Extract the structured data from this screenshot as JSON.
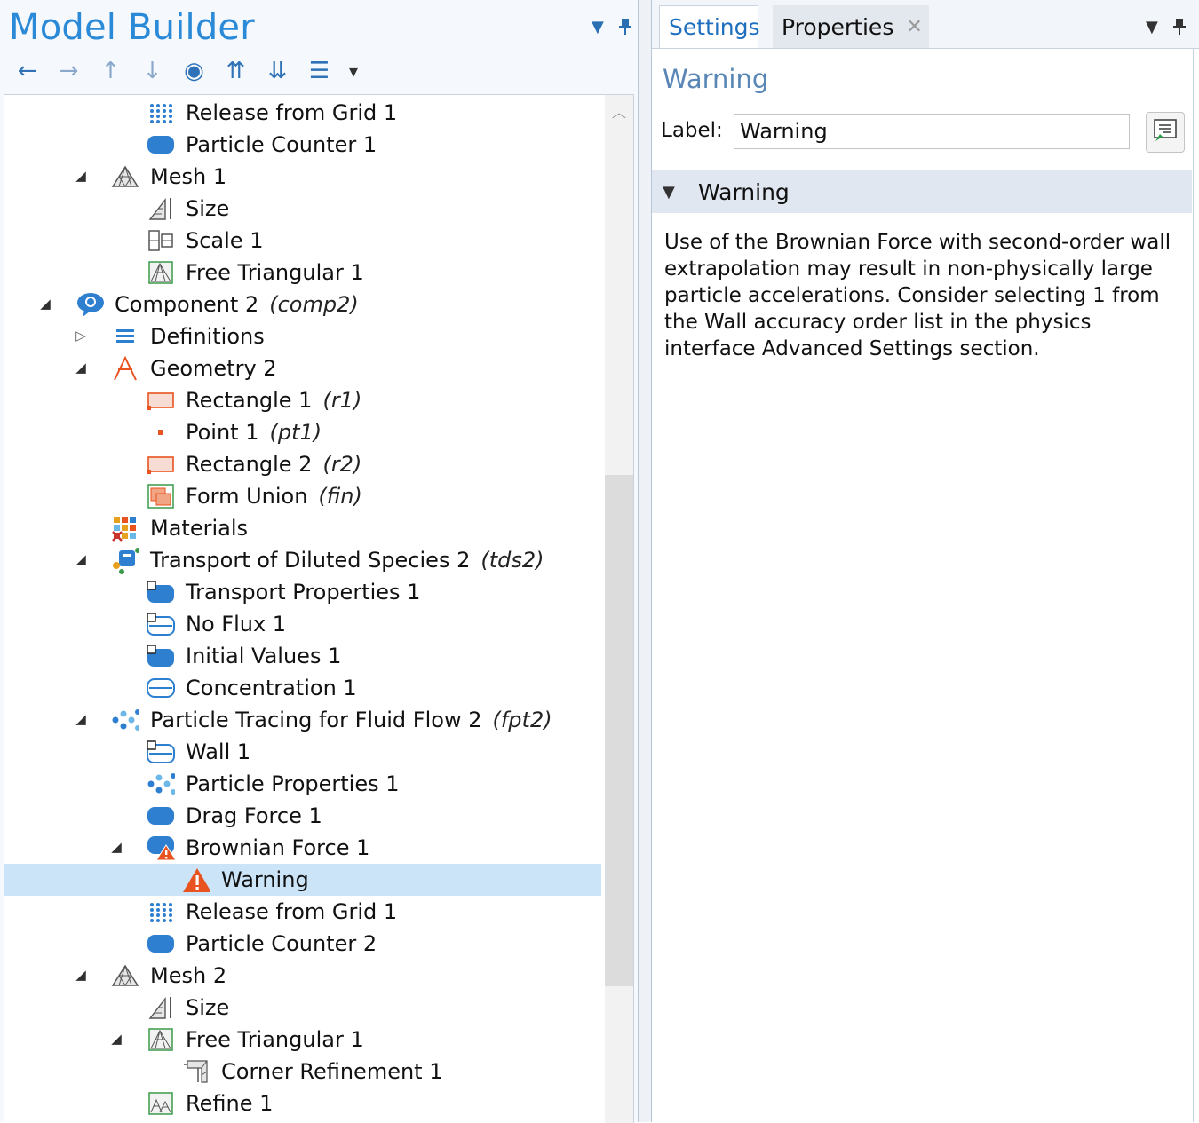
{
  "model_builder": {
    "title": "Model Builder",
    "toolbar": [
      {
        "name": "back-icon",
        "glyph": "←"
      },
      {
        "name": "forward-icon",
        "glyph": "→"
      },
      {
        "name": "move-up-icon",
        "glyph": "↑"
      },
      {
        "name": "move-down-icon",
        "glyph": "↓"
      },
      {
        "name": "show-icon",
        "glyph": "◉"
      },
      {
        "name": "collapse-all-icon",
        "glyph": "⇈"
      },
      {
        "name": "expand-all-icon",
        "glyph": "⇊"
      },
      {
        "name": "tree-options-icon",
        "glyph": "☰"
      },
      {
        "name": "toolbar-dropdown-icon",
        "glyph": "▾"
      }
    ],
    "tree": [
      {
        "label": "Release from Grid 1",
        "level": 3,
        "icon": "release-grid-icon"
      },
      {
        "label": "Particle Counter 1",
        "level": 3,
        "icon": "particle-counter-icon"
      },
      {
        "label": "Mesh 1",
        "level": 2,
        "icon": "mesh-icon",
        "expander": "open"
      },
      {
        "label": "Size",
        "level": 3,
        "icon": "size-icon"
      },
      {
        "label": "Scale 1",
        "level": 3,
        "icon": "scale-icon"
      },
      {
        "label": "Free Triangular 1",
        "level": 3,
        "icon": "free-triangular-icon"
      },
      {
        "label": "Component 2",
        "tag": "(comp2)",
        "level": 1,
        "icon": "component-icon",
        "expander": "open"
      },
      {
        "label": "Definitions",
        "level": 2,
        "icon": "definitions-icon",
        "expander": "closed"
      },
      {
        "label": "Geometry 2",
        "level": 2,
        "icon": "geometry-icon",
        "expander": "open"
      },
      {
        "label": "Rectangle 1",
        "tag": "(r1)",
        "level": 3,
        "icon": "rectangle-icon"
      },
      {
        "label": "Point 1",
        "tag": "(pt1)",
        "level": 3,
        "icon": "point-icon"
      },
      {
        "label": "Rectangle 2",
        "tag": "(r2)",
        "level": 3,
        "icon": "rectangle-icon"
      },
      {
        "label": "Form Union",
        "tag": "(fin)",
        "level": 3,
        "icon": "form-union-icon"
      },
      {
        "label": "Materials",
        "level": 2,
        "icon": "materials-icon"
      },
      {
        "label": "Transport of Diluted Species 2",
        "tag": "(tds2)",
        "level": 2,
        "icon": "transport-icon",
        "expander": "open"
      },
      {
        "label": "Transport Properties 1",
        "level": 3,
        "icon": "domain-feature-icon"
      },
      {
        "label": "No Flux 1",
        "level": 3,
        "icon": "boundary-feature-icon"
      },
      {
        "label": "Initial Values 1",
        "level": 3,
        "icon": "domain-feature-icon"
      },
      {
        "label": "Concentration 1",
        "level": 3,
        "icon": "boundary-plain-icon"
      },
      {
        "label": "Particle Tracing for Fluid Flow 2",
        "tag": "(fpt2)",
        "level": 2,
        "icon": "particle-tracing-icon",
        "expander": "open"
      },
      {
        "label": "Wall 1",
        "level": 3,
        "icon": "boundary-feature-icon"
      },
      {
        "label": "Particle Properties 1",
        "level": 3,
        "icon": "particle-tracing-icon"
      },
      {
        "label": "Drag Force 1",
        "level": 3,
        "icon": "particle-counter-icon"
      },
      {
        "label": "Brownian Force 1",
        "level": 3,
        "icon": "force-warning-icon",
        "expander": "open"
      },
      {
        "label": "Warning",
        "level": 4,
        "icon": "warning-icon",
        "selected": true
      },
      {
        "label": "Release from Grid 1",
        "level": 3,
        "icon": "release-grid-icon"
      },
      {
        "label": "Particle Counter 2",
        "level": 3,
        "icon": "particle-counter-icon"
      },
      {
        "label": "Mesh 2",
        "level": 2,
        "icon": "mesh-icon",
        "expander": "open"
      },
      {
        "label": "Size",
        "level": 3,
        "icon": "size-icon"
      },
      {
        "label": "Free Triangular 1",
        "level": 3,
        "icon": "free-triangular-icon",
        "expander": "open"
      },
      {
        "label": "Corner Refinement 1",
        "level": 4,
        "icon": "corner-refinement-icon"
      },
      {
        "label": "Refine 1",
        "level": 3,
        "icon": "refine-icon"
      }
    ]
  },
  "settings": {
    "tabs": {
      "settings": "Settings",
      "properties": "Properties",
      "close_glyph": "✕"
    },
    "title": "Warning",
    "label_caption": "Label:",
    "label_value": "Warning",
    "section_title": "Warning",
    "message": "Use of the Brownian Force with second-order wall extrapolation may result in non-physically large particle accelerations. Consider selecting 1 from the Wall accuracy order list in the physics interface Advanced Settings section."
  },
  "colors": {
    "accent": "#2b8ad8",
    "selection": "#cce4f7",
    "section_header": "#e0e7f0",
    "warning": "#e8531f"
  }
}
